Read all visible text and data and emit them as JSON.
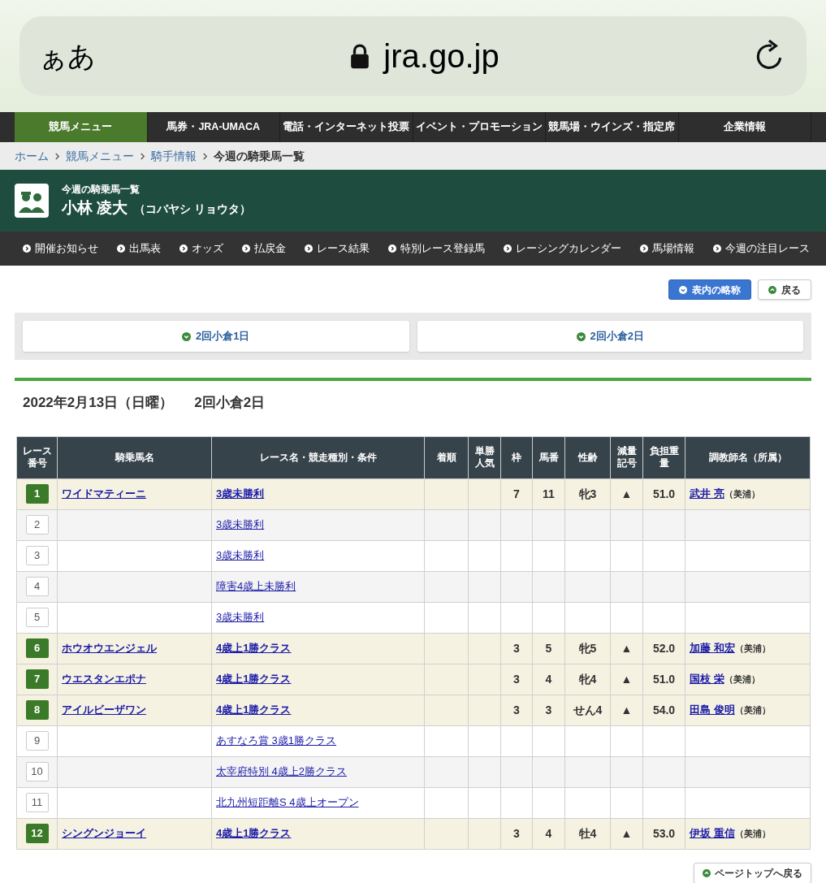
{
  "browser": {
    "text_size": "ぁあ",
    "url": "jra.go.jp"
  },
  "nav": [
    {
      "label": "競馬メニュー",
      "selected": true
    },
    {
      "label": "馬券・JRA-UMACA",
      "selected": false
    },
    {
      "label": "電話・インターネット投票",
      "selected": false
    },
    {
      "label": "イベント・プロモーション",
      "selected": false
    },
    {
      "label": "競馬場・ウインズ・指定席",
      "selected": false
    },
    {
      "label": "企業情報",
      "selected": false
    }
  ],
  "breadcrumb": [
    {
      "label": "ホーム",
      "current": false
    },
    {
      "label": "競馬メニュー",
      "current": false
    },
    {
      "label": "騎手情報",
      "current": false
    },
    {
      "label": "今週の騎乗馬一覧",
      "current": true
    }
  ],
  "header": {
    "subtitle": "今週の騎乗馬一覧",
    "name": "小林 凌大",
    "reading": "（コバヤシ リョウタ）"
  },
  "subnav": [
    "開催お知らせ",
    "出馬表",
    "オッズ",
    "払戻金",
    "レース結果",
    "特別レース登録馬",
    "レーシングカレンダー",
    "馬場情報",
    "今週の注目レース"
  ],
  "buttons": [
    {
      "label": "表内の略称",
      "kind": "primary"
    },
    {
      "label": "戻る",
      "kind": "back"
    }
  ],
  "meeting_tabs": [
    "2回小倉1日",
    "2回小倉2日"
  ],
  "date_heading": {
    "date": "2022年2月13日（日曜）",
    "meeting": "2回小倉2日"
  },
  "table": {
    "columns": [
      "レース番号",
      "騎乗馬名",
      "レース名・競走種別・条件",
      "着順",
      "単勝人気",
      "枠",
      "馬番",
      "性齢",
      "減量記号",
      "負担重量",
      "調教師名（所属）"
    ],
    "rows": [
      {
        "kind": "ride",
        "race": "1",
        "horse": "ワイドマティーニ",
        "race_name": "3歳未勝利",
        "frame": "7",
        "number": "11",
        "sex_age": "牝3",
        "mark": "▲",
        "weight": "51.0",
        "trainer": "武井 亮",
        "stable": "（美浦）"
      },
      {
        "kind": "none",
        "race": "2",
        "race_name": "3歳未勝利"
      },
      {
        "kind": "none",
        "race": "3",
        "race_name": "3歳未勝利"
      },
      {
        "kind": "none",
        "race": "4",
        "race_name": "障害4歳上未勝利"
      },
      {
        "kind": "none",
        "race": "5",
        "race_name": "3歳未勝利"
      },
      {
        "kind": "ride",
        "race": "6",
        "horse": "ホウオウエンジェル",
        "race_name": "4歳上1勝クラス",
        "frame": "3",
        "number": "5",
        "sex_age": "牝5",
        "mark": "▲",
        "weight": "52.0",
        "trainer": "加藤 和宏",
        "stable": "（美浦）"
      },
      {
        "kind": "ride",
        "race": "7",
        "horse": "ウエスタンエポナ",
        "race_name": "4歳上1勝クラス",
        "frame": "3",
        "number": "4",
        "sex_age": "牝4",
        "mark": "▲",
        "weight": "51.0",
        "trainer": "国枝 栄",
        "stable": "（美浦）"
      },
      {
        "kind": "ride",
        "race": "8",
        "horse": "アイルビーザワン",
        "race_name": "4歳上1勝クラス",
        "frame": "3",
        "number": "3",
        "sex_age": "せん4",
        "mark": "▲",
        "weight": "54.0",
        "trainer": "田島 俊明",
        "stable": "（美浦）"
      },
      {
        "kind": "none",
        "race": "9",
        "race_name": "あすなろ賞 3歳1勝クラス"
      },
      {
        "kind": "none",
        "race": "10",
        "race_name": "太宰府特別 4歳上2勝クラス"
      },
      {
        "kind": "none",
        "race": "11",
        "race_name": "北九州短距離S 4歳上オープン"
      },
      {
        "kind": "ride",
        "race": "12",
        "horse": "シングンジョーイ",
        "race_name": "4歳上1勝クラス",
        "frame": "3",
        "number": "4",
        "sex_age": "牡4",
        "mark": "▲",
        "weight": "53.0",
        "trainer": "伊坂 重信",
        "stable": "（美浦）"
      }
    ]
  },
  "page_top": "ページトップへ戻る"
}
